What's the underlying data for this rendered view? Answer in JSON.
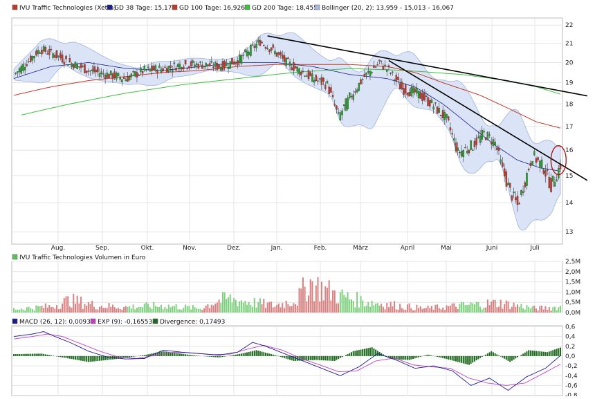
{
  "chart_data": [
    {
      "type": "candlestick",
      "title": "",
      "legend": [
        {
          "label": "IVU Traffic Technologies (Xetra)",
          "color": "#c0392b"
        },
        {
          "label": "GD 38 Tage: 15,17",
          "color": "#1a1a8c"
        },
        {
          "label": "GD 100 Tage: 16,926",
          "color": "#c0392b"
        },
        {
          "label": "GD 200 Tage: 18,455",
          "color": "#3fbf3f"
        },
        {
          "label": "Bollinger (20, 2): 13,959 - 15,013 - 16,067",
          "color": "#a8b8e0"
        }
      ],
      "x_tick_labels": [
        "Aug.",
        "Sep.",
        "Okt.",
        "Nov.",
        "Dez.",
        "Jan.",
        "Feb.",
        "März",
        "April",
        "Mai",
        "Juni",
        "Juli"
      ],
      "y_tick_labels": [
        "22",
        "21",
        "20",
        "19",
        "18",
        "17",
        "16",
        "15",
        "14",
        "13"
      ],
      "y_scale": "log",
      "ylim": [
        12.6,
        22.4
      ],
      "grid": true,
      "close_points": [
        [
          0,
          19.4
        ],
        [
          8,
          20.1
        ],
        [
          14,
          20.7
        ],
        [
          22,
          20.4
        ],
        [
          30,
          20.0
        ],
        [
          40,
          19.6
        ],
        [
          50,
          19.4
        ],
        [
          60,
          19.2
        ],
        [
          70,
          19.6
        ],
        [
          80,
          19.7
        ],
        [
          90,
          19.9
        ],
        [
          100,
          19.9
        ],
        [
          110,
          19.8
        ],
        [
          120,
          20.1
        ],
        [
          132,
          21.1
        ],
        [
          138,
          20.7
        ],
        [
          146,
          20.0
        ],
        [
          155,
          19.5
        ],
        [
          160,
          19.2
        ],
        [
          168,
          18.9
        ],
        [
          174,
          17.4
        ],
        [
          180,
          18.3
        ],
        [
          188,
          19.3
        ],
        [
          196,
          20.0
        ],
        [
          201,
          19.6
        ],
        [
          208,
          18.7
        ],
        [
          216,
          18.5
        ],
        [
          224,
          18.0
        ],
        [
          232,
          17.3
        ],
        [
          238,
          15.9
        ],
        [
          246,
          16.2
        ],
        [
          252,
          16.7
        ],
        [
          258,
          16.3
        ],
        [
          262,
          15.2
        ],
        [
          266,
          14.4
        ],
        [
          270,
          13.9
        ],
        [
          274,
          14.8
        ],
        [
          278,
          15.8
        ],
        [
          284,
          15.3
        ],
        [
          288,
          14.6
        ],
        [
          293,
          15.4
        ]
      ],
      "ma38_points": [
        [
          0,
          19.2
        ],
        [
          20,
          19.8
        ],
        [
          40,
          20.0
        ],
        [
          60,
          19.7
        ],
        [
          80,
          19.6
        ],
        [
          100,
          19.8
        ],
        [
          120,
          20.0
        ],
        [
          140,
          20.0
        ],
        [
          160,
          19.8
        ],
        [
          180,
          19.4
        ],
        [
          200,
          19.2
        ],
        [
          215,
          18.8
        ],
        [
          230,
          18.0
        ],
        [
          245,
          17.0
        ],
        [
          258,
          16.2
        ],
        [
          270,
          15.6
        ],
        [
          282,
          15.3
        ],
        [
          293,
          15.17
        ]
      ],
      "ma100_points": [
        [
          0,
          18.4
        ],
        [
          20,
          18.8
        ],
        [
          40,
          19.1
        ],
        [
          60,
          19.3
        ],
        [
          80,
          19.5
        ],
        [
          100,
          19.6
        ],
        [
          120,
          19.8
        ],
        [
          140,
          19.9
        ],
        [
          160,
          19.9
        ],
        [
          180,
          19.9
        ],
        [
          200,
          19.8
        ],
        [
          215,
          19.5
        ],
        [
          230,
          19.0
        ],
        [
          250,
          18.4
        ],
        [
          265,
          17.8
        ],
        [
          280,
          17.2
        ],
        [
          293,
          16.926
        ]
      ],
      "ma200_points": [
        [
          4,
          17.5
        ],
        [
          30,
          18.0
        ],
        [
          60,
          18.5
        ],
        [
          90,
          18.9
        ],
        [
          120,
          19.2
        ],
        [
          150,
          19.5
        ],
        [
          180,
          19.7
        ],
        [
          210,
          19.6
        ],
        [
          240,
          19.4
        ],
        [
          265,
          19.1
        ],
        [
          280,
          18.8
        ],
        [
          293,
          18.455
        ]
      ],
      "trendlines": [
        {
          "from": [
            136,
            21.4
          ],
          "to": [
            300,
            18.6
          ]
        },
        {
          "from": [
            201,
            20.1
          ],
          "to": [
            300,
            15.0
          ]
        }
      ],
      "highlight_marker": {
        "x": 292,
        "y": 15.6
      }
    },
    {
      "type": "bar",
      "title": "",
      "legend": [
        {
          "label": "IVU Traffic Technologies Volumen in Euro",
          "color": "#5cbf5c"
        }
      ],
      "y_tick_labels": [
        "2,5M",
        "2,0M",
        "1,5M",
        "1,0M",
        "0,5M",
        "0,0M"
      ],
      "ylim": [
        0,
        2.5
      ],
      "unit": "Mio. Euro",
      "up_color": "#7fd07f",
      "down_color": "#d98080",
      "peak_points": [
        [
          0,
          0.25
        ],
        [
          20,
          0.45
        ],
        [
          30,
          0.9
        ],
        [
          45,
          0.5
        ],
        [
          60,
          0.4
        ],
        [
          80,
          0.5
        ],
        [
          100,
          0.3
        ],
        [
          108,
          0.8
        ],
        [
          115,
          1.0
        ],
        [
          140,
          0.5
        ],
        [
          152,
          0.95
        ],
        [
          158,
          2.2
        ],
        [
          162,
          1.9
        ],
        [
          175,
          1.2
        ],
        [
          188,
          0.8
        ],
        [
          200,
          0.6
        ],
        [
          220,
          0.3
        ],
        [
          240,
          0.5
        ],
        [
          260,
          0.7
        ],
        [
          280,
          0.3
        ],
        [
          293,
          0.4
        ]
      ]
    },
    {
      "type": "line",
      "title": "",
      "legend": [
        {
          "label": "MACD (26, 12): 0,00939",
          "color": "#1a1a8c"
        },
        {
          "label": "EXP (9): -0,16553",
          "color": "#c040c0"
        },
        {
          "label": "Divergence: 0,17493",
          "color": "#1e6b1e"
        }
      ],
      "y_tick_labels": [
        "0,6",
        "0,4",
        "0,2",
        "0,0",
        "-0,2",
        "-0,4",
        "-0,6",
        "-0,8"
      ],
      "ylim": [
        -0.82,
        0.62
      ],
      "macd_points": [
        [
          0,
          0.4
        ],
        [
          10,
          0.45
        ],
        [
          16,
          0.5
        ],
        [
          22,
          0.4
        ],
        [
          30,
          0.28
        ],
        [
          40,
          0.1
        ],
        [
          50,
          -0.02
        ],
        [
          60,
          -0.06
        ],
        [
          70,
          -0.05
        ],
        [
          80,
          0.12
        ],
        [
          90,
          0.08
        ],
        [
          100,
          0.05
        ],
        [
          110,
          0.02
        ],
        [
          120,
          0.08
        ],
        [
          128,
          0.28
        ],
        [
          135,
          0.2
        ],
        [
          145,
          0.05
        ],
        [
          155,
          -0.1
        ],
        [
          165,
          -0.25
        ],
        [
          175,
          -0.4
        ],
        [
          185,
          -0.22
        ],
        [
          195,
          0.05
        ],
        [
          205,
          -0.08
        ],
        [
          215,
          -0.25
        ],
        [
          225,
          -0.2
        ],
        [
          235,
          -0.3
        ],
        [
          245,
          -0.6
        ],
        [
          255,
          -0.45
        ],
        [
          265,
          -0.7
        ],
        [
          275,
          -0.42
        ],
        [
          285,
          -0.25
        ],
        [
          293,
          0.01
        ]
      ],
      "signal_points": [
        [
          0,
          0.35
        ],
        [
          10,
          0.4
        ],
        [
          18,
          0.45
        ],
        [
          26,
          0.4
        ],
        [
          36,
          0.25
        ],
        [
          46,
          0.1
        ],
        [
          56,
          -0.02
        ],
        [
          66,
          -0.05
        ],
        [
          76,
          0.02
        ],
        [
          86,
          0.08
        ],
        [
          96,
          0.06
        ],
        [
          106,
          0.03
        ],
        [
          116,
          0.04
        ],
        [
          126,
          0.15
        ],
        [
          134,
          0.22
        ],
        [
          144,
          0.12
        ],
        [
          154,
          -0.05
        ],
        [
          164,
          -0.18
        ],
        [
          174,
          -0.32
        ],
        [
          184,
          -0.3
        ],
        [
          194,
          -0.1
        ],
        [
          204,
          -0.04
        ],
        [
          214,
          -0.18
        ],
        [
          224,
          -0.22
        ],
        [
          234,
          -0.25
        ],
        [
          244,
          -0.45
        ],
        [
          254,
          -0.55
        ],
        [
          264,
          -0.6
        ],
        [
          274,
          -0.55
        ],
        [
          284,
          -0.35
        ],
        [
          293,
          -0.166
        ]
      ],
      "divergence_points": [
        [
          0,
          0.04
        ],
        [
          15,
          0.05
        ],
        [
          25,
          -0.02
        ],
        [
          40,
          -0.12
        ],
        [
          55,
          -0.06
        ],
        [
          70,
          0.02
        ],
        [
          80,
          0.1
        ],
        [
          95,
          0.02
        ],
        [
          110,
          -0.03
        ],
        [
          122,
          0.05
        ],
        [
          130,
          0.12
        ],
        [
          140,
          0.02
        ],
        [
          150,
          -0.1
        ],
        [
          162,
          -0.08
        ],
        [
          172,
          -0.1
        ],
        [
          182,
          0.1
        ],
        [
          192,
          0.18
        ],
        [
          202,
          -0.06
        ],
        [
          212,
          -0.08
        ],
        [
          222,
          0.03
        ],
        [
          232,
          -0.06
        ],
        [
          244,
          -0.18
        ],
        [
          256,
          0.1
        ],
        [
          266,
          -0.12
        ],
        [
          276,
          0.12
        ],
        [
          286,
          0.08
        ],
        [
          293,
          0.175
        ]
      ]
    }
  ]
}
